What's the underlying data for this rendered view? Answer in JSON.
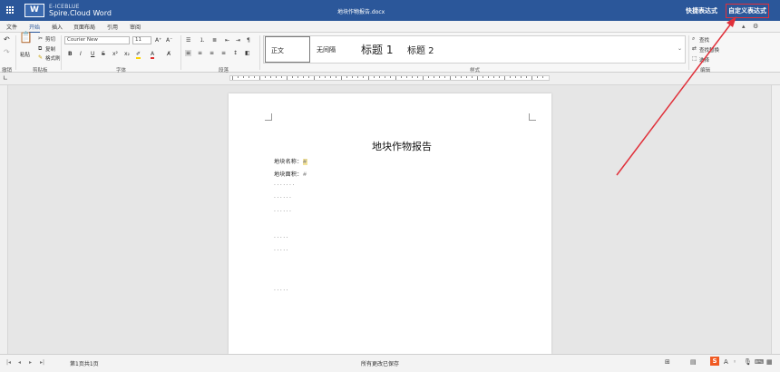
{
  "titlebar": {
    "brand_top": "E-ICEBLUE",
    "brand": "Spire.Cloud Word",
    "logo_letter": "W",
    "doc_title": "地块作物报告.docx",
    "quick_expr": "快捷表达式",
    "custom_expr": "自定义表达式"
  },
  "tabs": [
    {
      "label": "文件"
    },
    {
      "label": "开始"
    },
    {
      "label": "插入"
    },
    {
      "label": "页面布局"
    },
    {
      "label": "引用"
    },
    {
      "label": "审阅"
    }
  ],
  "ribbon": {
    "clipboard": {
      "label": "剪贴板",
      "paste": "粘贴",
      "cut": "剪切",
      "copy": "复制",
      "format": "格式刷",
      "undo": "撤销"
    },
    "font": {
      "label": "字体",
      "name": "Courier New",
      "size": "11"
    },
    "paragraph": {
      "label": "段落"
    },
    "styles": {
      "label": "样式",
      "items": [
        {
          "label": "正文"
        },
        {
          "label": "无间隔"
        },
        {
          "label": "标题 1"
        },
        {
          "label": "标题 2"
        }
      ]
    },
    "edit": {
      "label": "编辑",
      "find": "查找",
      "find_replace": "查找替换",
      "select": "选择"
    }
  },
  "document": {
    "heading": "地块作物报告",
    "line1_label": "地块名称：",
    "line1_mark": "#",
    "line2_label": "地块面积：",
    "line2_mark": "#",
    "dot_rows": [
      "·······",
      "······",
      "······",
      "·····",
      "·····",
      "·····"
    ]
  },
  "statusbar": {
    "page_info": "第1页共1页",
    "save_status": "所有更改已保存",
    "sogou": "S"
  },
  "colors": {
    "titlebar_bg": "#2b579a",
    "highlight_box": "#e0303a"
  }
}
